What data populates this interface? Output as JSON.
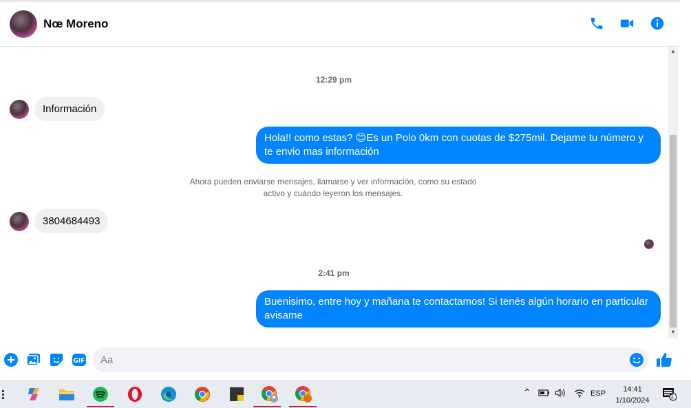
{
  "header": {
    "contact_name": "Nœ Moreno",
    "actions": [
      "phone-icon",
      "video-icon",
      "info-icon"
    ]
  },
  "chat": {
    "time_1": "12:29 pm",
    "msg_in_1": "Información",
    "msg_out_1": "Hola!! como estas? 😊Es un Polo 0km con cuotas de $275mil. Dejame tu número y te envio mas información",
    "system_line_1": "Ahora pueden enviarse mensajes, llamarse y ver información, como su estado",
    "system_line_2": "activo y cuándo leyeron los mensajes.",
    "msg_in_2": "3804684493",
    "time_2": "2:41 pm",
    "msg_out_2": "Buenisimo, entre hoy y mañana te contactamos! Si tenés algún horario en particular avisame"
  },
  "composer": {
    "placeholder": "Aa"
  },
  "taskbar": {
    "language": "ESP",
    "time": "14:41",
    "date": "1/10/2024",
    "notification_count": "1"
  },
  "colors": {
    "accent": "#0084ff",
    "incoming_bubble": "#f0f0f0"
  }
}
